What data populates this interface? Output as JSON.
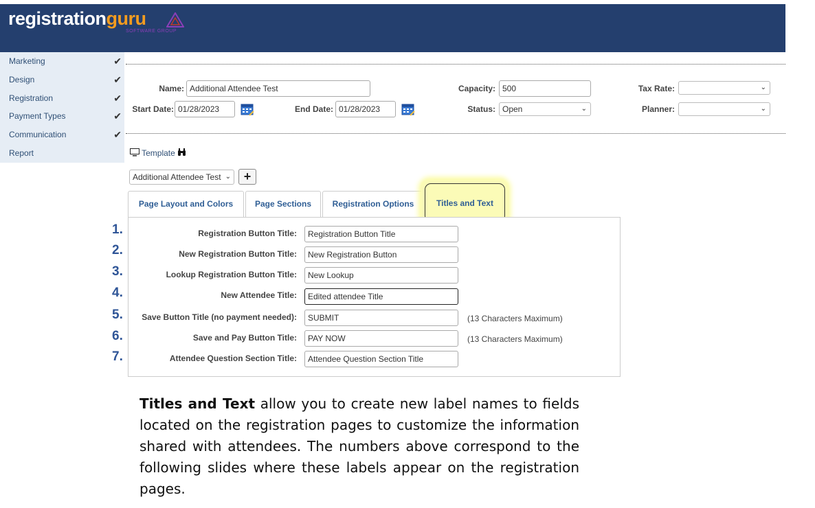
{
  "header": {
    "logo_part1": "registration",
    "logo_part2": "guru",
    "logo_sub": "SOFTWARE GROUP",
    "bg_color": "#243f6e",
    "accent_color": "#f39c1f"
  },
  "sidebar": {
    "items": [
      {
        "label": "Marketing",
        "check": true
      },
      {
        "label": "Design",
        "check": true
      },
      {
        "label": "Registration",
        "check": true
      },
      {
        "label": "Payment Types",
        "check": true
      },
      {
        "label": "Communication",
        "check": true
      },
      {
        "label": "Report",
        "check": false
      }
    ]
  },
  "event": {
    "name_label": "Name:",
    "name_value": "Additional Attendee Test",
    "start_label": "Start Date:",
    "start_value": "01/28/2023",
    "end_label": "End Date:",
    "end_value": "01/28/2023",
    "capacity_label": "Capacity:",
    "capacity_value": "500",
    "status_label": "Status:",
    "status_value": "Open",
    "tax_label": "Tax Rate:",
    "tax_value": "",
    "planner_label": "Planner:",
    "planner_value": ""
  },
  "template": {
    "label": "Template",
    "selected": "Additional Attendee Test",
    "add_label": "+"
  },
  "tabs": [
    {
      "label": "Page Layout and Colors"
    },
    {
      "label": "Page Sections"
    },
    {
      "label": "Registration Options"
    },
    {
      "label": "Titles and Text",
      "active": true
    }
  ],
  "fields": [
    {
      "num": "1.",
      "label": "Registration Button Title:",
      "value": "Registration Button Title",
      "hint": ""
    },
    {
      "num": "2.",
      "label": "New Registration Button Title:",
      "value": "New Registration Button",
      "hint": ""
    },
    {
      "num": "3.",
      "label": "Lookup Registration Button Title:",
      "value": "New Lookup",
      "hint": ""
    },
    {
      "num": "4.",
      "label": "New Attendee Title:",
      "value": "Edited attendee Title",
      "hint": ""
    },
    {
      "num": "5.",
      "label": "Save Button Title (no payment needed):",
      "value": "SUBMIT",
      "hint": "(13 Characters Maximum)"
    },
    {
      "num": "6.",
      "label": "Save and Pay Button Title:",
      "value": "PAY NOW",
      "hint": "(13 Characters Maximum)"
    },
    {
      "num": "7.",
      "label": "Attendee Question Section Title:",
      "value": "Attendee Question Section Title",
      "hint": ""
    }
  ],
  "description": {
    "bold": "Titles and Text",
    "rest": " allow you to create new label names to fields located on the registration pages to customize the information shared with attendees.  The numbers above correspond to the following slides where these labels appear on the registration pages."
  }
}
